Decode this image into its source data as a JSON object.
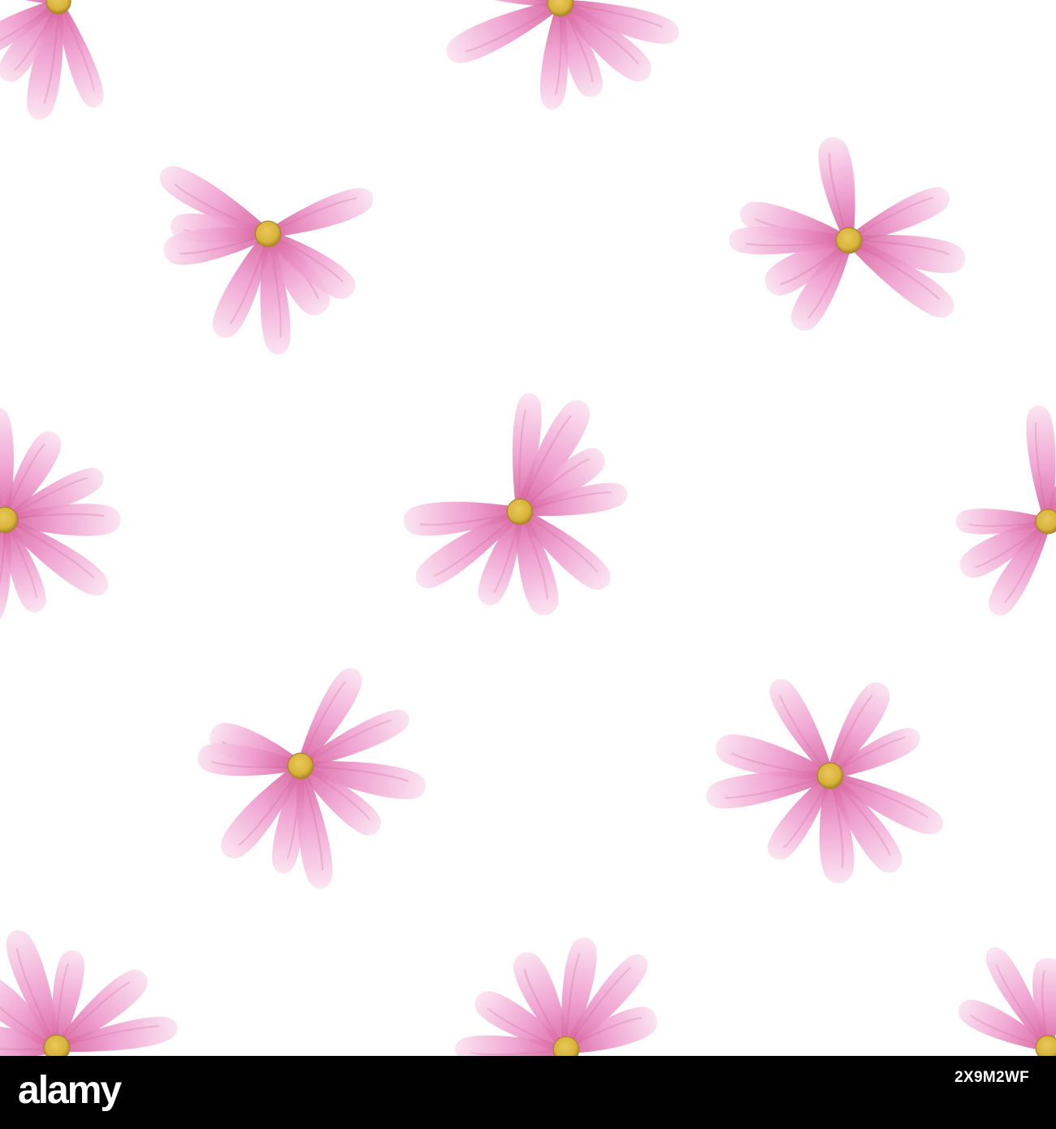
{
  "pattern": {
    "background_color": "#ffffff",
    "petal_color_light": "#fbe3f1",
    "petal_color_mid": "#ef9fcf",
    "petal_color_dark": "#d8639f",
    "center_color": "#d9b33a",
    "center_edge_color": "#a9842a",
    "icon": "watercolor-pink-flower"
  },
  "footer": {
    "background_color": "#000000",
    "brand_logo_text": "alamy",
    "image_id": "2X9M2WF"
  }
}
